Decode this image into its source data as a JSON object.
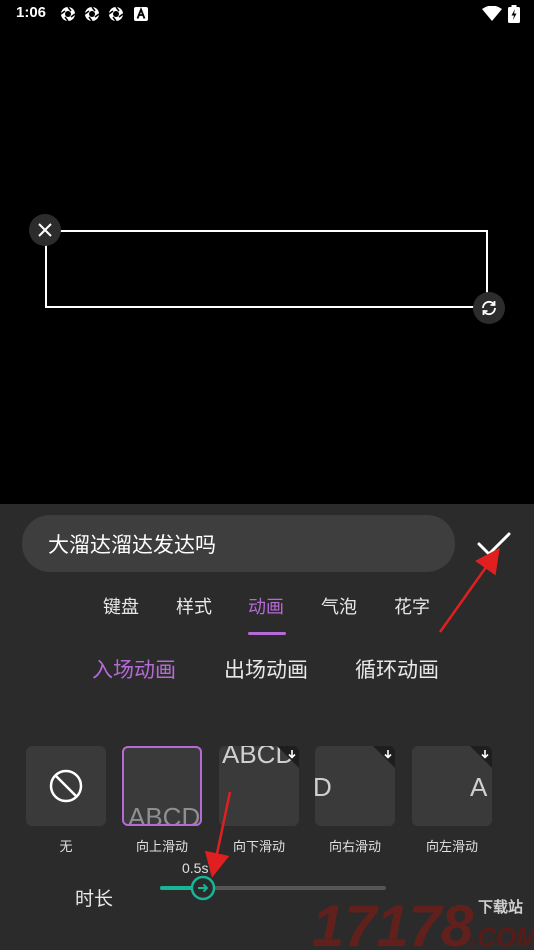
{
  "status_bar": {
    "time": "1:06",
    "notification_icons": [
      "aperture-icon",
      "aperture-icon",
      "aperture-icon",
      "a-badge-icon"
    ],
    "right_icons": [
      "wifi-icon",
      "battery-charging-icon"
    ]
  },
  "editor": {
    "text_value": "大溜达溜达发达吗",
    "confirm_icon": "checkmark-icon",
    "delete_icon": "close-icon",
    "rotate_icon": "rotate-icon"
  },
  "tabs": [
    {
      "label": "键盘",
      "active": false
    },
    {
      "label": "样式",
      "active": false
    },
    {
      "label": "动画",
      "active": true
    },
    {
      "label": "气泡",
      "active": false
    },
    {
      "label": "花字",
      "active": false
    }
  ],
  "subtabs": [
    {
      "label": "入场动画",
      "active": true
    },
    {
      "label": "出场动画",
      "active": false
    },
    {
      "label": "循环动画",
      "active": false
    }
  ],
  "animations": [
    {
      "label": "无",
      "preview_text": "",
      "selected": false
    },
    {
      "label": "向上滑动",
      "preview_text": "ABCD",
      "selected": true
    },
    {
      "label": "向下滑动",
      "preview_text": "ABCD",
      "selected": false
    },
    {
      "label": "向右滑动",
      "preview_text": "D",
      "selected": false
    },
    {
      "label": "向左滑动",
      "preview_text": "A",
      "selected": false
    }
  ],
  "duration": {
    "label": "时长",
    "value_text": "0.5s",
    "level_fraction": 0.19
  },
  "watermark": {
    "number": "17178",
    "site": "下载站",
    "domain": ".COM"
  },
  "colors": {
    "accent": "#b66ad6",
    "slider": "#19b597",
    "annotation_arrow": "#e02020"
  }
}
